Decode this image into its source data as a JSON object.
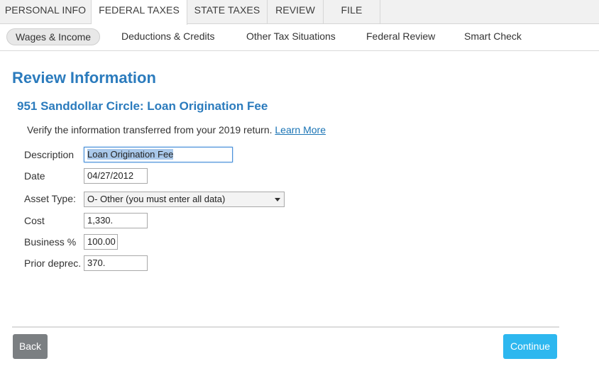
{
  "top_tabs": [
    "PERSONAL INFO",
    "FEDERAL TAXES",
    "STATE TAXES",
    "REVIEW",
    "FILE"
  ],
  "sub_nav": [
    "Wages & Income",
    "Deductions & Credits",
    "Other Tax Situations",
    "Federal Review",
    "Smart Check"
  ],
  "page_title": "Review Information",
  "section_title": "951 Sanddollar Circle: Loan Origination Fee",
  "verify": {
    "text": "Verify the information transferred from your 2019 return.",
    "link": "Learn More"
  },
  "form": {
    "description_label": "Description",
    "description_value": "Loan Origination Fee",
    "date_label": "Date",
    "date_value": "04/27/2012",
    "asset_type_label": "Asset Type:",
    "asset_type_value": "O- Other (you must enter all data)",
    "cost_label": "Cost",
    "cost_value": "1,330.",
    "business_label": "Business %",
    "business_value": "100.00",
    "prior_label": "Prior deprec.",
    "prior_value": "370."
  },
  "buttons": {
    "back": "Back",
    "continue": "Continue"
  }
}
